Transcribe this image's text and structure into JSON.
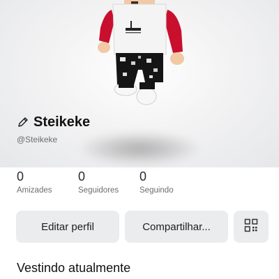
{
  "profile": {
    "display_name": "Steikeke",
    "username": "@Steikeke"
  },
  "stats": [
    {
      "value": "0",
      "label": "Amizades"
    },
    {
      "value": "0",
      "label": "Seguidores"
    },
    {
      "value": "0",
      "label": "Seguindo"
    }
  ],
  "actions": {
    "edit_label": "Editar perfil",
    "share_label": "Compartilhar...",
    "qr_icon": "qr-code-icon"
  },
  "sections": {
    "wearing_title": "Vestindo atualmente"
  },
  "colors": {
    "button_bg": "#ebecee",
    "shirt_red": "#c8102e",
    "text_secondary": "#6b6d70"
  }
}
